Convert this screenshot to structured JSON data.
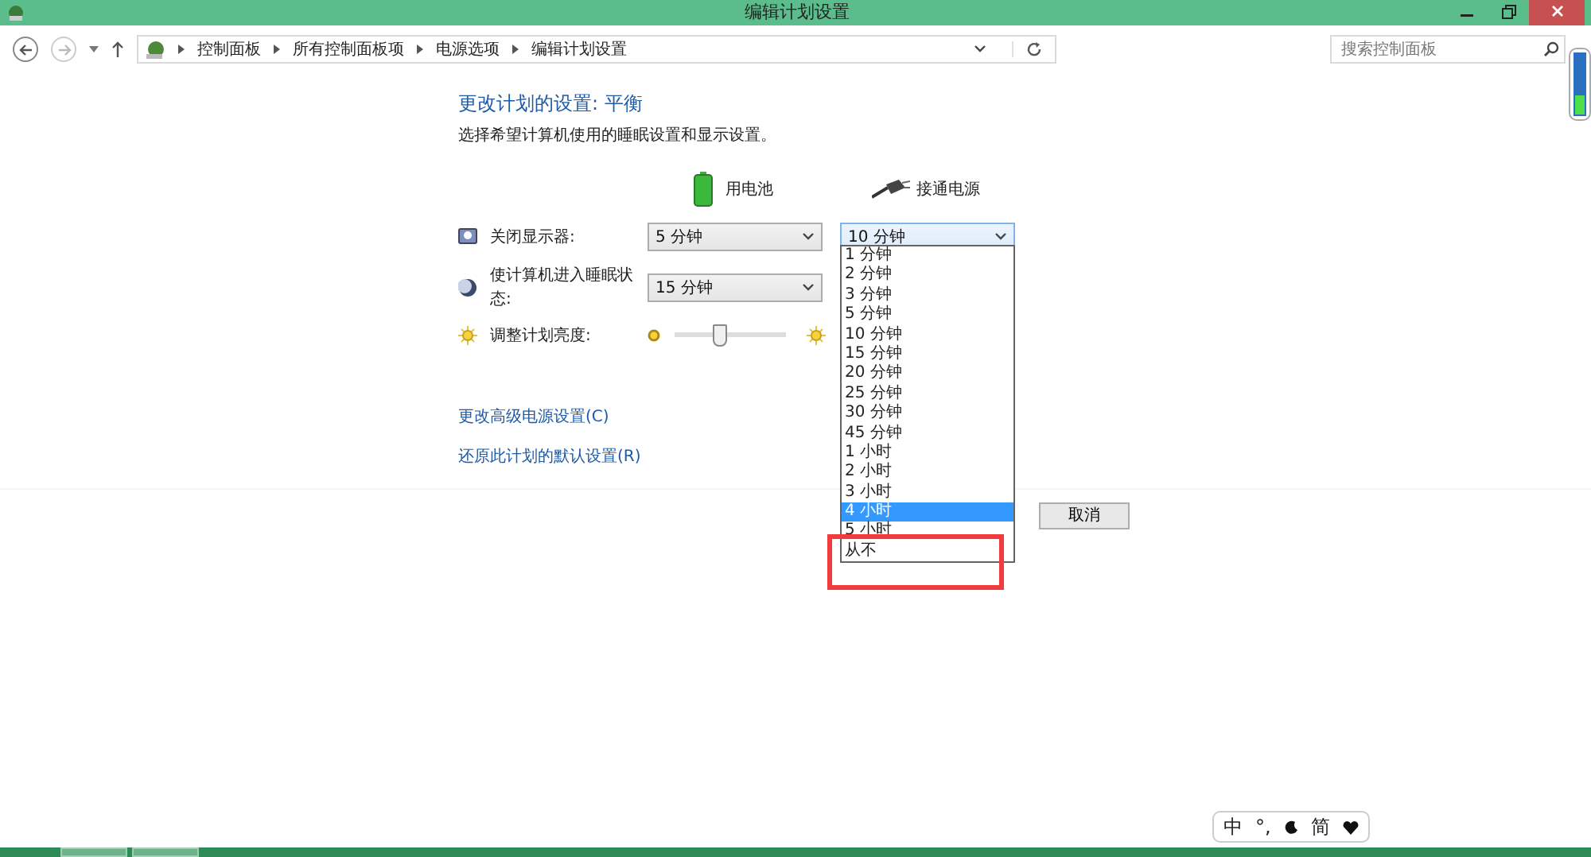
{
  "window": {
    "title": "编辑计划设置"
  },
  "address_bar": {
    "breadcrumbs": [
      "控制面板",
      "所有控制面板项",
      "电源选项",
      "编辑计划设置"
    ]
  },
  "search": {
    "placeholder": "搜索控制面板"
  },
  "heading": "更改计划的设置: 平衡",
  "subtitle": "选择希望计算机使用的睡眠设置和显示设置。",
  "columns": [
    "用电池",
    "接通电源"
  ],
  "settings": [
    {
      "kind": "select",
      "label": "关闭显示器:",
      "battery": "5 分钟",
      "plugged": "10 分钟",
      "expanded": true
    },
    {
      "kind": "select",
      "label": "使计算机进入睡眠状态:",
      "battery": "15 分钟"
    },
    {
      "kind": "slider",
      "label": "调整计划亮度:",
      "level": 0.4
    }
  ],
  "dropdown_options": [
    {
      "label": "1 分钟",
      "selected": false
    },
    {
      "label": "2 分钟",
      "selected": false
    },
    {
      "label": "3 分钟",
      "selected": false
    },
    {
      "label": "5 分钟",
      "selected": false
    },
    {
      "label": "10 分钟",
      "selected": false
    },
    {
      "label": "15 分钟",
      "selected": false
    },
    {
      "label": "20 分钟",
      "selected": false
    },
    {
      "label": "25 分钟",
      "selected": false
    },
    {
      "label": "30 分钟",
      "selected": false
    },
    {
      "label": "45 分钟",
      "selected": false
    },
    {
      "label": "1 小时",
      "selected": false
    },
    {
      "label": "2 小时",
      "selected": false
    },
    {
      "label": "3 小时",
      "selected": false
    },
    {
      "label": "4 小时",
      "selected": true
    },
    {
      "label": "5 小时",
      "selected": false
    },
    {
      "label": "从不",
      "selected": false
    }
  ],
  "links": [
    "更改高级电源设置(C)",
    "还原此计划的默认设置(R)"
  ],
  "buttons": [
    "取消"
  ],
  "ime_toolbar": [
    "中",
    "°,",
    "简"
  ]
}
